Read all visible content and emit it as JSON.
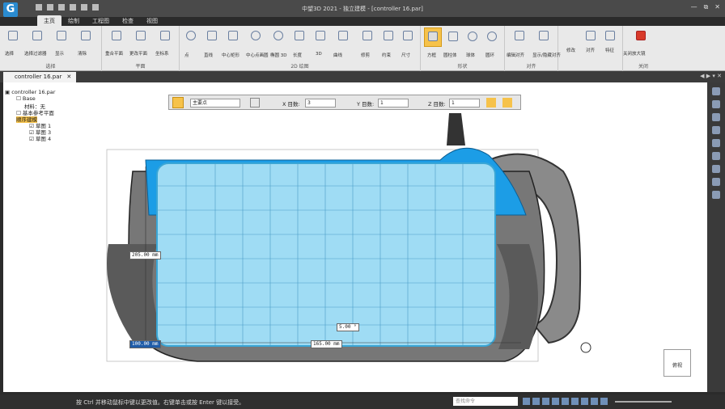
{
  "titlebar": {
    "logo_letter": "G",
    "title": "中望3D 2021 - 独立建模 - [controller 16.par]",
    "controls": [
      "—",
      "⧉",
      "✕"
    ]
  },
  "tabs": [
    {
      "label": "主页",
      "active": true
    },
    {
      "label": "绘制"
    },
    {
      "label": "工程图"
    },
    {
      "label": "检查"
    },
    {
      "label": "视图"
    }
  ],
  "ribbon": {
    "groups": [
      {
        "label": "选择"
      },
      {
        "label": "平面"
      },
      {
        "label": "2D 绘图"
      },
      {
        "label": "形状"
      },
      {
        "label": "对齐"
      },
      {
        "label": "关闭"
      }
    ],
    "buttons": [
      "选择",
      "选择过滤器",
      "显示",
      "清除",
      "重合平面",
      "更改平面",
      "坐标系",
      "点",
      "直线",
      "中心矩形",
      "中心点画圆",
      "椭圆 3D",
      "长度",
      "3D",
      "曲线",
      "修剪",
      "约束",
      "尺寸",
      "标注",
      "方框",
      "圆柱体",
      "球体",
      "圆环",
      "编辑对齐",
      "显示/隐藏对齐",
      "修改",
      "对齐",
      "特征",
      "关闭",
      "关闭放大镜"
    ]
  },
  "document_tab": {
    "label": "controller 16.par",
    "close": "✕"
  },
  "tree": {
    "root": "controller 16.par",
    "items": [
      {
        "label": "Base",
        "level": 1
      },
      {
        "label": "材料：无",
        "level": 2
      },
      {
        "label": "基本参考平面",
        "level": 1
      },
      {
        "label": "顺序建模",
        "level": 1,
        "highlighted": true
      },
      {
        "label": "草图 1",
        "level": 2
      },
      {
        "label": "草图 3",
        "level": 2
      },
      {
        "label": "草图 4",
        "level": 2
      }
    ]
  },
  "commandbar": {
    "plane_select": "主要点",
    "x_label": "X 目数:",
    "x_value": "3",
    "y_label": "Y 目数:",
    "y_value": "1",
    "z_label": "Z 目数:",
    "z_value": "1"
  },
  "dimensions": {
    "height": "205.00 mm",
    "width_bottom": "165.00 mm",
    "offset_left": "100.00 mm",
    "small": "5.00 °"
  },
  "viewcube_label": "俯视",
  "status": {
    "message": "按 Ctrl 并移动鼠标中键以更改值。右键单击或按 Enter 键以接受。",
    "search_placeholder": "查找命令"
  },
  "colors": {
    "block_fill": "#9fdcf4",
    "block_stroke": "#3aa6d6",
    "blue_top": "#1c9de6",
    "highlight": "#f7c34a"
  }
}
